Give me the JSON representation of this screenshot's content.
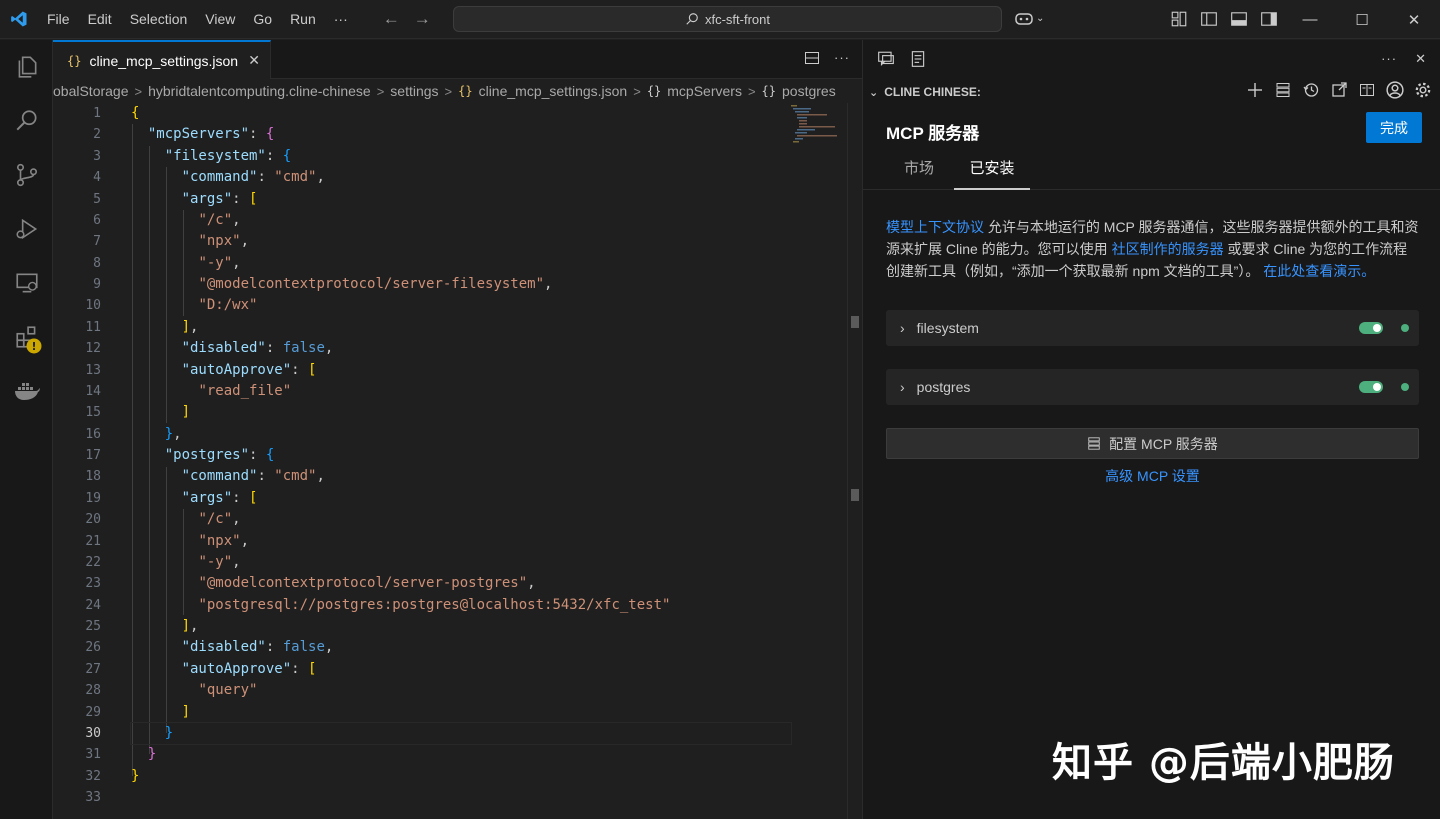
{
  "titlebar": {
    "menu": [
      "File",
      "Edit",
      "Selection",
      "View",
      "Go",
      "Run",
      "···"
    ],
    "search": "xfc-sft-front"
  },
  "editor": {
    "tab_label": "cline_mcp_settings.json",
    "breadcrumb": [
      "obalStorage",
      "hybridtalentcomputing.cline-chinese",
      "settings",
      "cline_mcp_settings.json",
      "mcpServers",
      "postgres"
    ],
    "current_line": 30,
    "lines": [
      [
        [
          "b1",
          "{"
        ]
      ],
      [
        [
          "ind",
          "  "
        ],
        [
          "key",
          "\"mcpServers\""
        ],
        [
          "pun",
          ": "
        ],
        [
          "b2",
          "{"
        ]
      ],
      [
        [
          "ind",
          "    "
        ],
        [
          "key",
          "\"filesystem\""
        ],
        [
          "pun",
          ": "
        ],
        [
          "b3",
          "{"
        ]
      ],
      [
        [
          "ind",
          "      "
        ],
        [
          "key",
          "\"command\""
        ],
        [
          "pun",
          ": "
        ],
        [
          "str",
          "\"cmd\""
        ],
        [
          "pun",
          ","
        ]
      ],
      [
        [
          "ind",
          "      "
        ],
        [
          "key",
          "\"args\""
        ],
        [
          "pun",
          ": "
        ],
        [
          "b1",
          "["
        ]
      ],
      [
        [
          "ind",
          "        "
        ],
        [
          "str",
          "\"/c\""
        ],
        [
          "pun",
          ","
        ]
      ],
      [
        [
          "ind",
          "        "
        ],
        [
          "str",
          "\"npx\""
        ],
        [
          "pun",
          ","
        ]
      ],
      [
        [
          "ind",
          "        "
        ],
        [
          "str",
          "\"-y\""
        ],
        [
          "pun",
          ","
        ]
      ],
      [
        [
          "ind",
          "        "
        ],
        [
          "str",
          "\"@modelcontextprotocol/server-filesystem\""
        ],
        [
          "pun",
          ","
        ]
      ],
      [
        [
          "ind",
          "        "
        ],
        [
          "str",
          "\"D:/wx\""
        ]
      ],
      [
        [
          "ind",
          "      "
        ],
        [
          "b1",
          "]"
        ],
        [
          "pun",
          ","
        ]
      ],
      [
        [
          "ind",
          "      "
        ],
        [
          "key",
          "\"disabled\""
        ],
        [
          "pun",
          ": "
        ],
        [
          "kw",
          "false"
        ],
        [
          "pun",
          ","
        ]
      ],
      [
        [
          "ind",
          "      "
        ],
        [
          "key",
          "\"autoApprove\""
        ],
        [
          "pun",
          ": "
        ],
        [
          "b1",
          "["
        ]
      ],
      [
        [
          "ind",
          "        "
        ],
        [
          "str",
          "\"read_file\""
        ]
      ],
      [
        [
          "ind",
          "      "
        ],
        [
          "b1",
          "]"
        ]
      ],
      [
        [
          "ind",
          "    "
        ],
        [
          "b3",
          "}"
        ],
        [
          "pun",
          ","
        ]
      ],
      [
        [
          "ind",
          "    "
        ],
        [
          "key",
          "\"postgres\""
        ],
        [
          "pun",
          ": "
        ],
        [
          "b3",
          "{"
        ]
      ],
      [
        [
          "ind",
          "      "
        ],
        [
          "key",
          "\"command\""
        ],
        [
          "pun",
          ": "
        ],
        [
          "str",
          "\"cmd\""
        ],
        [
          "pun",
          ","
        ]
      ],
      [
        [
          "ind",
          "      "
        ],
        [
          "key",
          "\"args\""
        ],
        [
          "pun",
          ": "
        ],
        [
          "b1",
          "["
        ]
      ],
      [
        [
          "ind",
          "        "
        ],
        [
          "str",
          "\"/c\""
        ],
        [
          "pun",
          ","
        ]
      ],
      [
        [
          "ind",
          "        "
        ],
        [
          "str",
          "\"npx\""
        ],
        [
          "pun",
          ","
        ]
      ],
      [
        [
          "ind",
          "        "
        ],
        [
          "str",
          "\"-y\""
        ],
        [
          "pun",
          ","
        ]
      ],
      [
        [
          "ind",
          "        "
        ],
        [
          "str",
          "\"@modelcontextprotocol/server-postgres\""
        ],
        [
          "pun",
          ","
        ]
      ],
      [
        [
          "ind",
          "        "
        ],
        [
          "str",
          "\"postgresql://postgres:postgres@localhost:5432/xfc_test\""
        ]
      ],
      [
        [
          "ind",
          "      "
        ],
        [
          "b1",
          "]"
        ],
        [
          "pun",
          ","
        ]
      ],
      [
        [
          "ind",
          "      "
        ],
        [
          "key",
          "\"disabled\""
        ],
        [
          "pun",
          ": "
        ],
        [
          "kw",
          "false"
        ],
        [
          "pun",
          ","
        ]
      ],
      [
        [
          "ind",
          "      "
        ],
        [
          "key",
          "\"autoApprove\""
        ],
        [
          "pun",
          ": "
        ],
        [
          "b1",
          "["
        ]
      ],
      [
        [
          "ind",
          "        "
        ],
        [
          "str",
          "\"query\""
        ]
      ],
      [
        [
          "ind",
          "      "
        ],
        [
          "b1",
          "]"
        ]
      ],
      [
        [
          "ind",
          "    "
        ],
        [
          "b3",
          "}"
        ]
      ],
      [
        [
          "ind",
          "  "
        ],
        [
          "b2",
          "}"
        ]
      ],
      [
        [
          "b1",
          "}"
        ]
      ],
      []
    ]
  },
  "panel": {
    "header": "CLINE CHINESE:",
    "title": "MCP 服务器",
    "done_label": "完成",
    "tabs": [
      "市场",
      "已安装"
    ],
    "active_tab": 1,
    "desc_link1": "模型上下文协议",
    "desc_text1": " 允许与本地运行的 MCP 服务器通信，这些服务器提供额外的工具和资源来扩展 Cline 的能力。您可以使用 ",
    "desc_link2": "社区制作的服务器",
    "desc_text2": " 或要求 Cline 为您的工作流程创建新工具（例如，“添加一个获取最新 npm 文档的工具”）。 ",
    "desc_link3": "在此处查看演示。",
    "servers": [
      {
        "name": "filesystem",
        "enabled": true,
        "status_color": "#4caf7d"
      },
      {
        "name": "postgres",
        "enabled": true,
        "status_color": "#4caf7d"
      }
    ],
    "config_label": "配置 MCP 服务器",
    "advanced_label": "高级 MCP 设置"
  },
  "watermark": "知乎 @后端小肥肠",
  "colors": {
    "accent": "#0078d4",
    "link": "#3794ff",
    "success": "#4caf7d"
  }
}
